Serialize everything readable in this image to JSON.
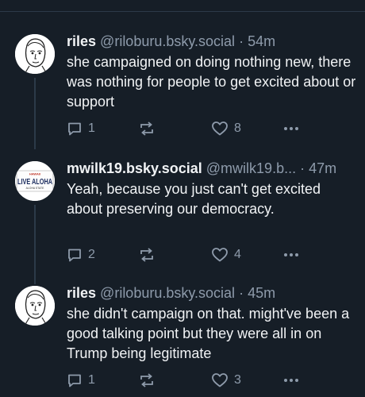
{
  "posts": [
    {
      "display_name": "riles",
      "handle": "@riloburu.bsky.social",
      "separator": "·",
      "time": "54m",
      "text": "she campaigned on doing nothing new, there was nothing for people to get excited about or support",
      "replies": "1",
      "reposts": "",
      "likes": "8",
      "avatar_icon": "sketch-face-avatar"
    },
    {
      "display_name": "mwilk19.bsky.social",
      "handle": "@mwilk19.b...",
      "separator": "·",
      "time": "47m",
      "text": "Yeah, because you just can't get excited about preserving our democracy.",
      "replies": "2",
      "reposts": "",
      "likes": "4",
      "avatar_icon": "license-plate-avatar",
      "avatar_text": {
        "top": "HAWAII",
        "main": "LIVE ALOHA",
        "bottom": "ALOHA STATE"
      }
    },
    {
      "display_name": "riles",
      "handle": "@riloburu.bsky.social",
      "separator": "·",
      "time": "45m",
      "text": "she didn't campaign on that. might've been a good talking point but they were all in on Trump being legitimate",
      "replies": "1",
      "reposts": "",
      "likes": "3",
      "avatar_icon": "sketch-face-avatar"
    }
  ],
  "icons": {
    "reply": "reply-bubble-icon",
    "repost": "repost-arrows-icon",
    "like": "heart-icon",
    "more": "more-dots-icon"
  },
  "colors": {
    "background": "#161e27",
    "text": "#f1f3f5",
    "muted": "#8e9bab",
    "divider": "#2c3a49"
  }
}
